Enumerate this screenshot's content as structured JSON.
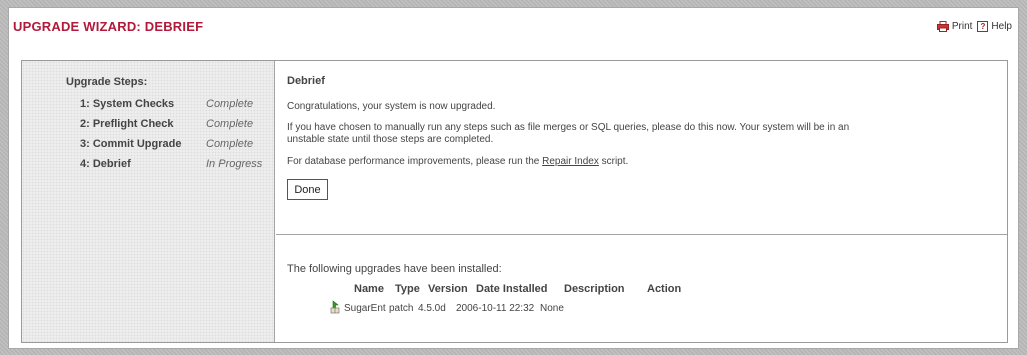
{
  "header": {
    "title": "UPGRADE WIZARD: DEBRIEF",
    "print_label": "Print",
    "help_label": "Help",
    "help_icon_glyph": "?"
  },
  "steps": {
    "heading": "Upgrade Steps:",
    "items": [
      {
        "label": "1: System Checks",
        "status": "Complete"
      },
      {
        "label": "2: Preflight Check",
        "status": "Complete"
      },
      {
        "label": "3: Commit Upgrade",
        "status": "Complete"
      },
      {
        "label": "4: Debrief",
        "status": "In Progress"
      }
    ]
  },
  "debrief": {
    "title": "Debrief",
    "message": "Congratulations, your system is now upgraded.",
    "instructions_line1": "If you have chosen to manually run any steps such as file merges or SQL queries, please do this now. Your system will be in an",
    "instructions_line2": "unstable state until those steps are completed.",
    "perf_prefix": "For database performance improvements, please run the ",
    "perf_link": "Repair Index",
    "perf_suffix": " script.",
    "done_label": "Done"
  },
  "installed": {
    "intro": "The following upgrades have been installed:",
    "columns": [
      "Name",
      "Type",
      "Version",
      "Date Installed",
      "Description",
      "Action"
    ],
    "rows": [
      {
        "name": "SugarEnt",
        "type": "patch",
        "version": "4.5.0d",
        "date": "2006-10-11 22:32",
        "description": "None",
        "action": ""
      }
    ]
  },
  "colors": {
    "title_red": "#b2193a",
    "icon_green": "#3a9a2a"
  }
}
